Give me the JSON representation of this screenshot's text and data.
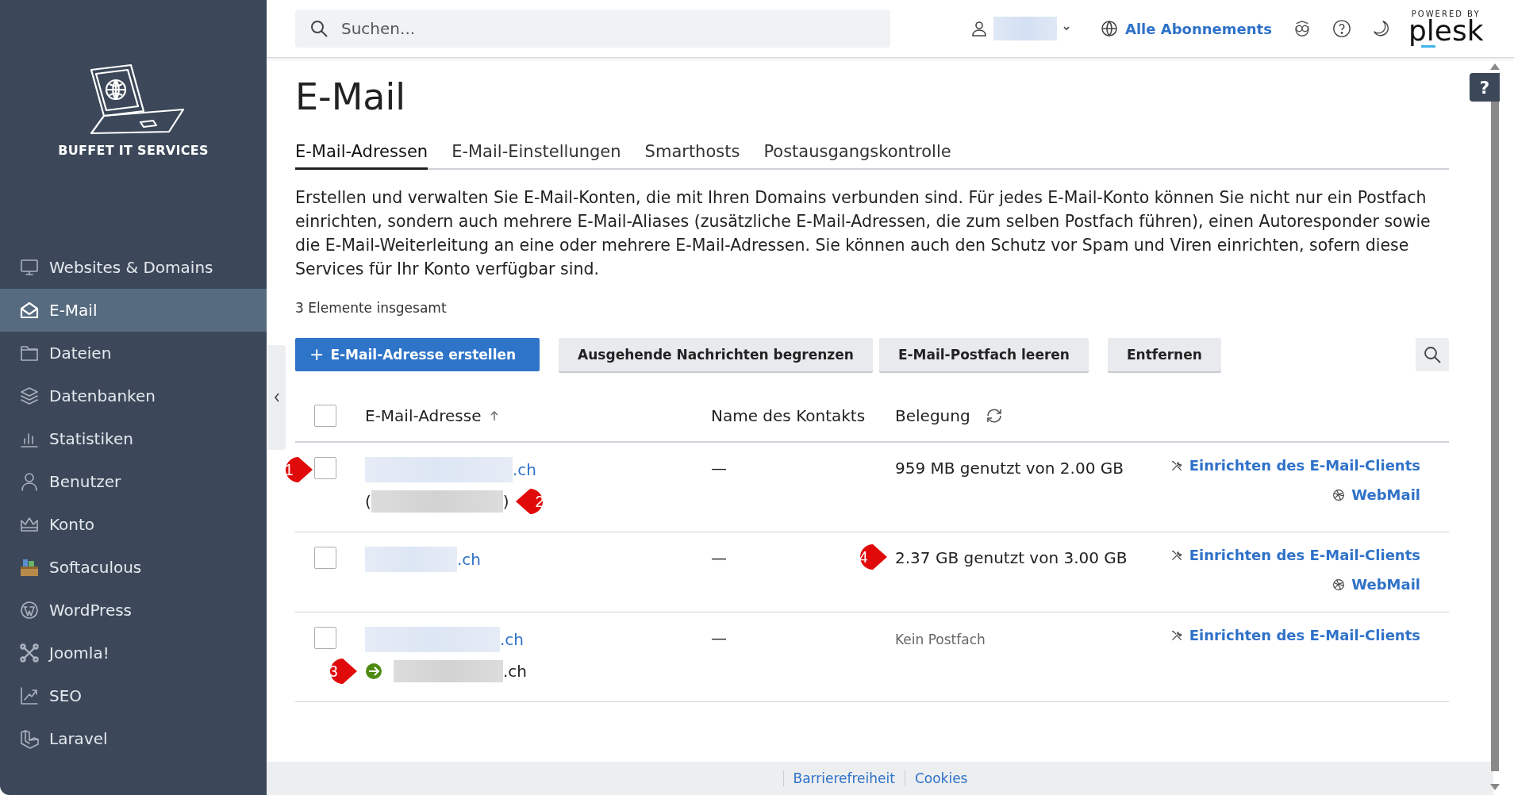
{
  "sidebar": {
    "brand": "BUFFET IT SERVICES",
    "items": [
      {
        "label": "Websites & Domains",
        "selected": false
      },
      {
        "label": "E-Mail",
        "selected": true
      },
      {
        "label": "Dateien",
        "selected": false
      },
      {
        "label": "Datenbanken",
        "selected": false
      },
      {
        "label": "Statistiken",
        "selected": false
      },
      {
        "label": "Benutzer",
        "selected": false
      },
      {
        "label": "Konto",
        "selected": false
      },
      {
        "label": "Softaculous",
        "selected": false
      },
      {
        "label": "WordPress",
        "selected": false
      },
      {
        "label": "Joomla!",
        "selected": false
      },
      {
        "label": "SEO",
        "selected": false
      },
      {
        "label": "Laravel",
        "selected": false
      }
    ]
  },
  "topbar": {
    "search": {
      "placeholder": "Suchen..."
    },
    "subscriptions": "Alle Abonnements",
    "powered_by": "POWERED BY",
    "logo": "plesk"
  },
  "page": {
    "title": "E-Mail",
    "tabs": [
      {
        "label": "E-Mail-Adressen",
        "selected": true
      },
      {
        "label": "E-Mail-Einstellungen",
        "selected": false
      },
      {
        "label": "Smarthosts",
        "selected": false
      },
      {
        "label": "Postausgangskontrolle",
        "selected": false
      }
    ],
    "description": "Erstellen und verwalten Sie E-Mail-Konten, die mit Ihren Domains verbunden sind. Für jedes E-Mail-Konto können Sie nicht nur ein Postfach einrichten, sondern auch mehrere E-Mail-Aliases (zusätzliche E-Mail-Adressen, die zum selben Postfach führen), einen Autoresponder sowie die E-Mail-Weiterleitung an eine oder mehrere E-Mail-Adressen. Sie können auch den Schutz vor Spam und Viren einrichten, sofern diese Services für Ihr Konto verfügbar sind.",
    "total": "3 Elemente insgesamt"
  },
  "toolbar": {
    "buttons": [
      {
        "label": "E-Mail-Adresse erstellen",
        "kind": "primary",
        "icon": "+"
      },
      {
        "label": "Ausgehende Nachrichten begrenzen",
        "kind": "secondary"
      },
      {
        "label": "E-Mail-Postfach leeren",
        "kind": "secondary"
      },
      {
        "label": "Entfernen",
        "kind": "secondary"
      }
    ]
  },
  "table": {
    "select_all": {
      "checked": false
    },
    "columns": [
      {
        "label": "E-Mail-Adresse",
        "sorted": true
      },
      {
        "label": "Name des Kontakts",
        "sorted": false
      },
      {
        "label": "Belegung",
        "sorted": false
      }
    ],
    "rows": [
      {
        "checked": false,
        "address": {
          "domain": ".ch",
          "callout": "1"
        },
        "sub_line": {
          "kind": "alias",
          "open": "(",
          "close": ")",
          "callout": "2"
        },
        "contact": "—",
        "usage": {
          "kind": "quota",
          "text": "959 MB genutzt von 2.00 GB"
        },
        "actions": [
          {
            "label": "Einrichten des E-Mail-Clients",
            "kind": "setup"
          },
          {
            "label": "WebMail",
            "kind": "webmail"
          }
        ]
      },
      {
        "checked": false,
        "address": {
          "domain": ".ch"
        },
        "contact": "—",
        "usage": {
          "kind": "quota",
          "text": "2.37 GB genutzt von 3.00 GB",
          "callout": "4"
        },
        "actions": [
          {
            "label": "Einrichten des E-Mail-Clients",
            "kind": "setup"
          },
          {
            "label": "WebMail",
            "kind": "webmail"
          }
        ]
      },
      {
        "checked": false,
        "address": {
          "domain": ".ch"
        },
        "sub_line": {
          "kind": "forward",
          "domain": ".ch",
          "callout": "3"
        },
        "contact": "—",
        "usage": {
          "kind": "none",
          "text": "Kein Postfach"
        },
        "actions": [
          {
            "label": "Einrichten des E-Mail-Clients",
            "kind": "setup"
          }
        ]
      }
    ]
  },
  "help_button": "?",
  "footer": {
    "links": [
      "Barrierefreiheit",
      "Cookies"
    ]
  }
}
